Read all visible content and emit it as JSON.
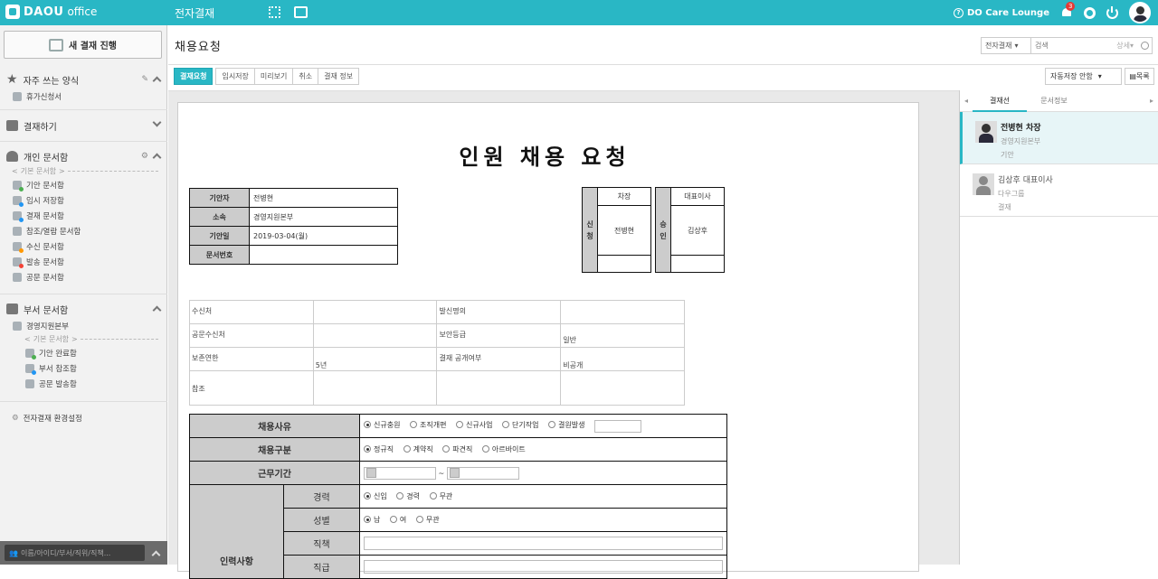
{
  "topbar": {
    "logo_brand": "DAOU",
    "logo_suffix": "office",
    "app_name": "전자결재",
    "care_lounge": "DO Care Lounge",
    "notif_count": "3"
  },
  "sidebar": {
    "new_button": "새 결재 진행",
    "fav": {
      "title": "자주 쓰는 양식",
      "items": [
        "휴가신청서"
      ]
    },
    "approve": {
      "title": "결재하기"
    },
    "personal": {
      "title": "개인 문서함",
      "sub_label": "기본 문서함",
      "items": [
        "기안 문서함",
        "임시 저장함",
        "결재 문서함",
        "참조/열람 문서함",
        "수신 문서함",
        "발송 문서함",
        "공문 문서함"
      ]
    },
    "dept": {
      "title": "부서 문서함",
      "dept_name": "경영지원본부",
      "sub_label": "기본 문서함",
      "items": [
        "기안 완료함",
        "부서 참조함",
        "공문 발송함"
      ]
    },
    "settings": "전자결재 환경설정",
    "search_placeholder": "이름/아이디/부서/직위/직책..."
  },
  "header": {
    "title": "채용요청",
    "search_scope": "전자결재",
    "search_placeholder": "검색",
    "detail": "상세"
  },
  "toolbar": {
    "buttons": [
      "결재요청",
      "임시저장",
      "미리보기",
      "취소",
      "결재 정보"
    ],
    "autosave": "자동저장 안함",
    "list": "목록"
  },
  "doc": {
    "title": "인원 채용 요청",
    "info": [
      {
        "label": "기안자",
        "value": "전병현"
      },
      {
        "label": "소속",
        "value": "경영지원본부"
      },
      {
        "label": "기안일",
        "value": "2019-03-04(월)"
      },
      {
        "label": "문서번호",
        "value": ""
      }
    ],
    "apply": {
      "side": [
        "신",
        "청"
      ],
      "role": "차장",
      "name": "전병현"
    },
    "approve": {
      "side": [
        "승",
        "인"
      ],
      "role": "대표이사",
      "name": "김상후"
    },
    "meta": {
      "recipient": "수신처",
      "sender": "발신명의",
      "public_recipient": "공문수신처",
      "security": "보안등급",
      "security_value": "일반",
      "retention": "보존연한",
      "retention_value": "5년",
      "disclosure": "결재 공개여부",
      "disclosure_value": "비공개",
      "reference": "참조"
    },
    "reason": {
      "label": "채용사유",
      "options": [
        "신규충원",
        "조직개편",
        "신규사업",
        "단기작업",
        "결원발생"
      ]
    },
    "type": {
      "label": "채용구분",
      "options": [
        "정규직",
        "계약직",
        "파견직",
        "아르바이트"
      ]
    },
    "period": {
      "label": "근무기간",
      "sep": "~"
    },
    "personnel": {
      "label": "인력사항",
      "career": {
        "label": "경력",
        "options": [
          "신입",
          "경력",
          "무관"
        ]
      },
      "gender": {
        "label": "성별",
        "options": [
          "남",
          "여",
          "무관"
        ]
      },
      "duty": {
        "label": "직책"
      },
      "rank": {
        "label": "직급"
      }
    }
  },
  "right_panel": {
    "tabs": [
      "결재선",
      "문서정보"
    ],
    "people": [
      {
        "name": "전병현 차장",
        "dept": "경영지원본부",
        "role": "기안"
      },
      {
        "name": "김상후 대표이사",
        "dept": "다우그룹",
        "role": "결재"
      }
    ]
  }
}
